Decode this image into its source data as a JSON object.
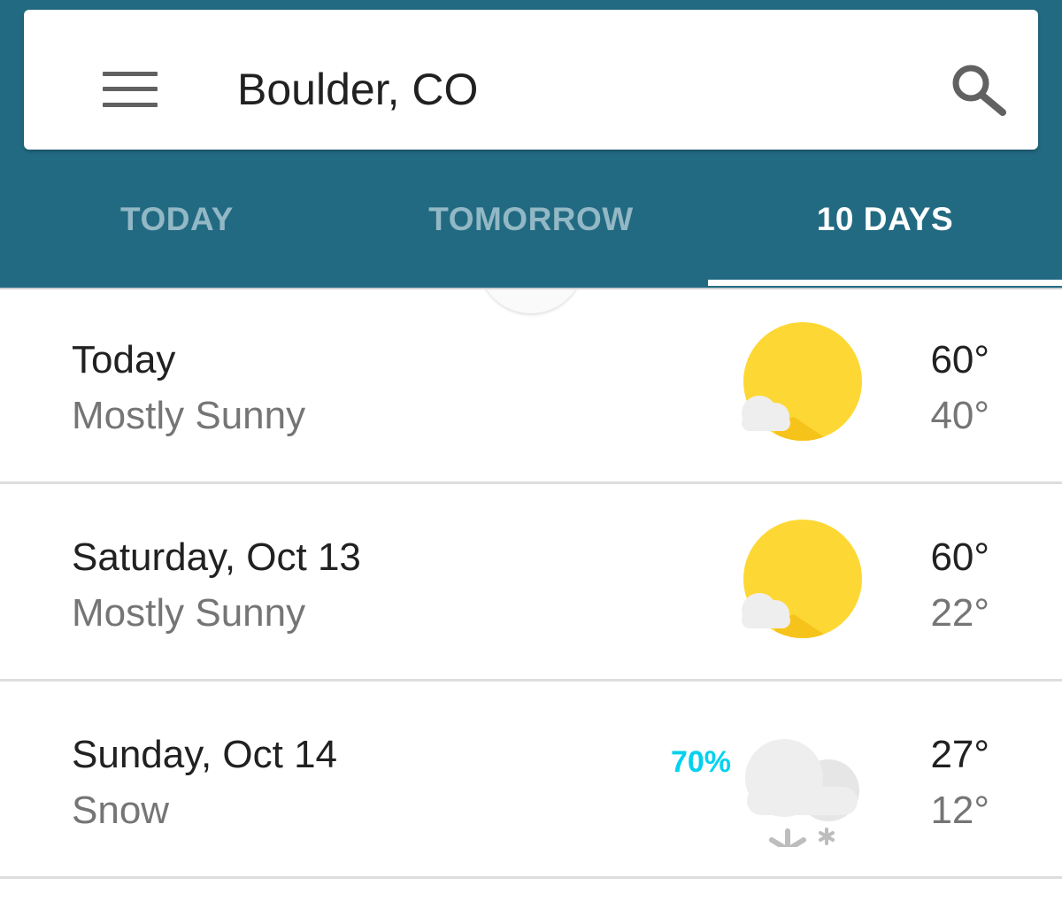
{
  "search": {
    "location": "Boulder, CO",
    "menu_icon": "hamburger-menu-icon",
    "search_icon": "magnifier-icon"
  },
  "tabs": [
    {
      "label": "TODAY",
      "active": false
    },
    {
      "label": "TOMORROW",
      "active": false
    },
    {
      "label": "10 DAYS",
      "active": true
    }
  ],
  "colors": {
    "header": "#226a82",
    "tab_inactive": "#93b8c5",
    "precip": "#00d2ee",
    "sun": "#fdd835"
  },
  "forecast": [
    {
      "day": "Today",
      "condition": "Mostly Sunny",
      "high": "60°",
      "low": "40°",
      "precip": "",
      "icon": "mostly-sunny-icon"
    },
    {
      "day": "Saturday, Oct 13",
      "condition": "Mostly Sunny",
      "high": "60°",
      "low": "22°",
      "precip": "",
      "icon": "mostly-sunny-icon"
    },
    {
      "day": "Sunday, Oct 14",
      "condition": "Snow",
      "high": "27°",
      "low": "12°",
      "precip": "70%",
      "icon": "snow-icon"
    }
  ]
}
